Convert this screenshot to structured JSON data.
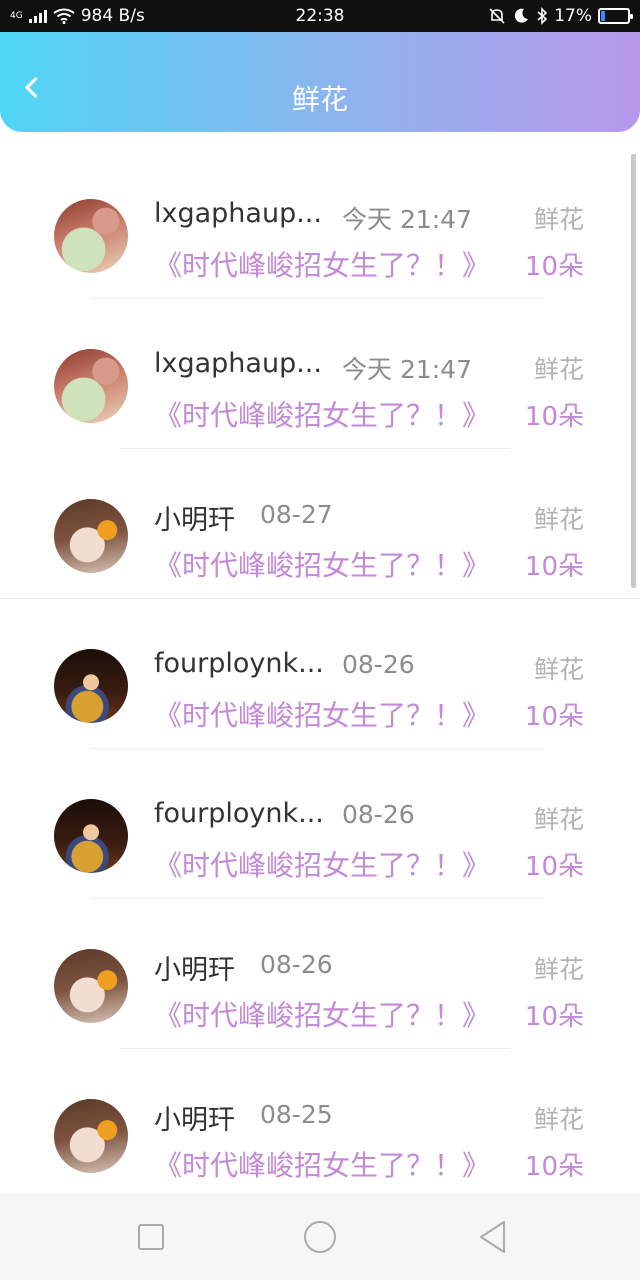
{
  "status_bar": {
    "network": "4G",
    "speed": "984 B/s",
    "time": "22:38",
    "battery": "17%",
    "battery_level": 0.17,
    "icons": [
      "signal-icon",
      "wifi-icon",
      "mute-icon",
      "moon-icon",
      "bluetooth-icon",
      "battery-icon"
    ]
  },
  "header": {
    "title": "鲜花",
    "back_icon": "back-chevron-icon",
    "accent_colors": [
      "#4fd6f5",
      "#b898ec"
    ]
  },
  "list": {
    "items": [
      {
        "avatar": "teacup-avatar",
        "name": "lxgaphaup...",
        "time": "今天 21:47",
        "gift": "鲜花",
        "article": "《时代峰峻招女生了？！》",
        "count": "10朵"
      },
      {
        "avatar": "teacup-avatar",
        "name": "lxgaphaup...",
        "time": "今天 21:47",
        "gift": "鲜花",
        "article": "《时代峰峻招女生了？！》",
        "count": "10朵"
      },
      {
        "avatar": "anime-avatar",
        "name": "小明玕",
        "time": "08-27",
        "gift": "鲜花",
        "article": "《时代峰峻招女生了？！》",
        "count": "10朵"
      },
      {
        "avatar": "woman-avatar",
        "name": "fourploynk...",
        "time": "08-26",
        "gift": "鲜花",
        "article": "《时代峰峻招女生了？！》",
        "count": "10朵"
      },
      {
        "avatar": "woman-avatar",
        "name": "fourploynk...",
        "time": "08-26",
        "gift": "鲜花",
        "article": "《时代峰峻招女生了？！》",
        "count": "10朵"
      },
      {
        "avatar": "anime-avatar",
        "name": "小明玕",
        "time": "08-26",
        "gift": "鲜花",
        "article": "《时代峰峻招女生了？！》",
        "count": "10朵"
      },
      {
        "avatar": "anime-avatar",
        "name": "小明玕",
        "time": "08-25",
        "gift": "鲜花",
        "article": "《时代峰峻招女生了？！》",
        "count": "10朵"
      }
    ],
    "accent_color": "#c489d7"
  },
  "nav_bar": {
    "icons": [
      "recent-apps-icon",
      "home-icon",
      "back-icon"
    ]
  }
}
